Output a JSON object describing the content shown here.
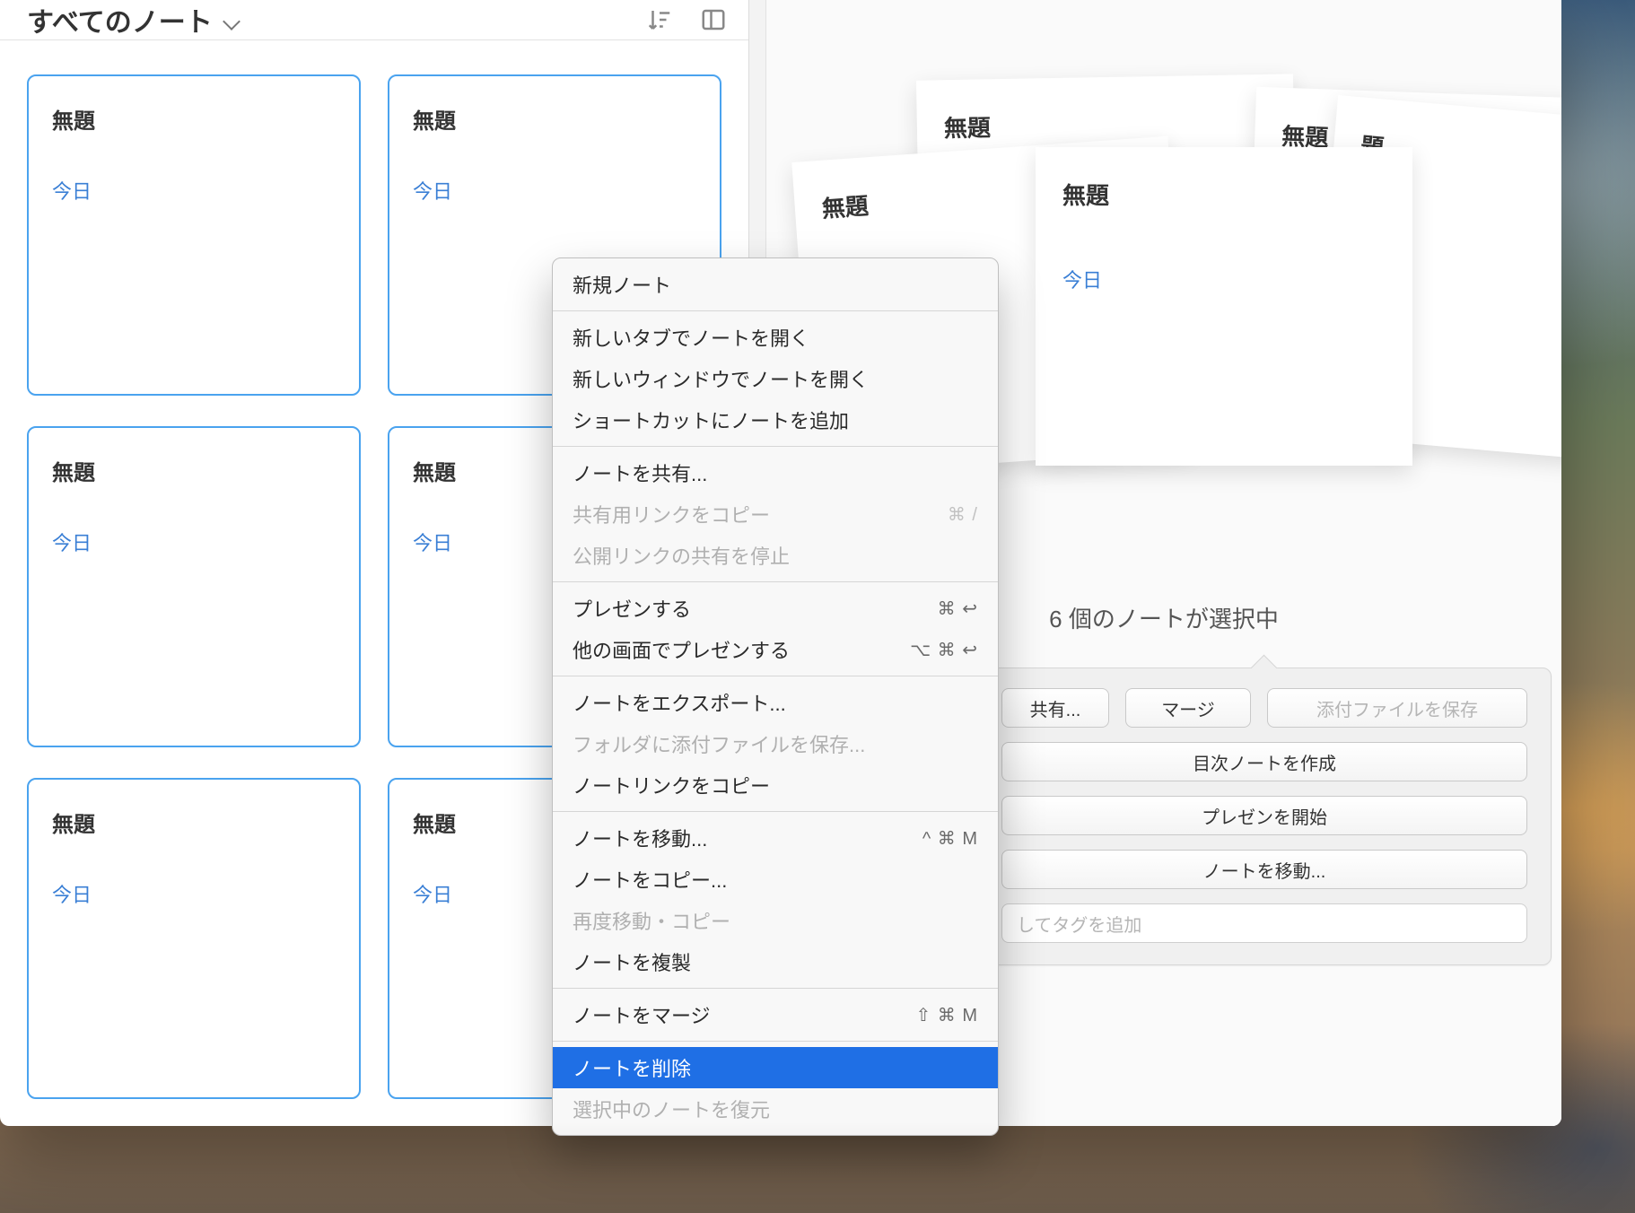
{
  "header": {
    "title": "すべてのノート",
    "icons": {
      "sort": "sort-icon",
      "view": "column-view-icon"
    }
  },
  "notes": [
    {
      "title": "無題",
      "date": "今日"
    },
    {
      "title": "無題",
      "date": "今日"
    },
    {
      "title": "無題",
      "date": "今日"
    },
    {
      "title": "無題",
      "date": "今日"
    },
    {
      "title": "無題",
      "date": "今日"
    },
    {
      "title": "無題",
      "date": "今日"
    }
  ],
  "stack": [
    {
      "title": "無題"
    },
    {
      "title": "無題"
    },
    {
      "title": "無題",
      "date": "今日"
    },
    {
      "title": "題"
    },
    {
      "title": "無題"
    }
  ],
  "selection": {
    "info": "6 個のノートが選択中",
    "buttons_row1": [
      {
        "label": "共有..."
      },
      {
        "label": "マージ"
      },
      {
        "label": "添付ファイルを保存",
        "disabled": true
      }
    ],
    "buttons_rows": [
      "目次ノートを作成",
      "プレゼンを開始",
      "ノートを移動..."
    ],
    "tag_placeholder": "してタグを追加"
  },
  "context_menu": [
    {
      "label": "新規ノート",
      "type": "item"
    },
    {
      "type": "sep"
    },
    {
      "label": "新しいタブでノートを開く",
      "type": "item"
    },
    {
      "label": "新しいウィンドウでノートを開く",
      "type": "item"
    },
    {
      "label": "ショートカットにノートを追加",
      "type": "item"
    },
    {
      "type": "sep"
    },
    {
      "label": "ノートを共有...",
      "type": "item"
    },
    {
      "label": "共有用リンクをコピー",
      "type": "item",
      "disabled": true,
      "shortcut": "⌘ /"
    },
    {
      "label": "公開リンクの共有を停止",
      "type": "item",
      "disabled": true
    },
    {
      "type": "sep"
    },
    {
      "label": "プレゼンする",
      "type": "item",
      "shortcut": "⌘ ↩"
    },
    {
      "label": "他の画面でプレゼンする",
      "type": "item",
      "shortcut": "⌥ ⌘ ↩"
    },
    {
      "type": "sep"
    },
    {
      "label": "ノートをエクスポート...",
      "type": "item"
    },
    {
      "label": "フォルダに添付ファイルを保存...",
      "type": "item",
      "disabled": true
    },
    {
      "label": "ノートリンクをコピー",
      "type": "item"
    },
    {
      "type": "sep"
    },
    {
      "label": "ノートを移動...",
      "type": "item",
      "shortcut": "^ ⌘ M"
    },
    {
      "label": "ノートをコピー...",
      "type": "item"
    },
    {
      "label": "再度移動・コピー",
      "type": "item",
      "disabled": true
    },
    {
      "label": "ノートを複製",
      "type": "item"
    },
    {
      "type": "sep"
    },
    {
      "label": "ノートをマージ",
      "type": "item",
      "shortcut": "⇧ ⌘ M"
    },
    {
      "type": "sep"
    },
    {
      "label": "ノートを削除",
      "type": "item",
      "selected": true
    },
    {
      "label": "選択中のノートを復元",
      "type": "item",
      "disabled": true
    }
  ]
}
